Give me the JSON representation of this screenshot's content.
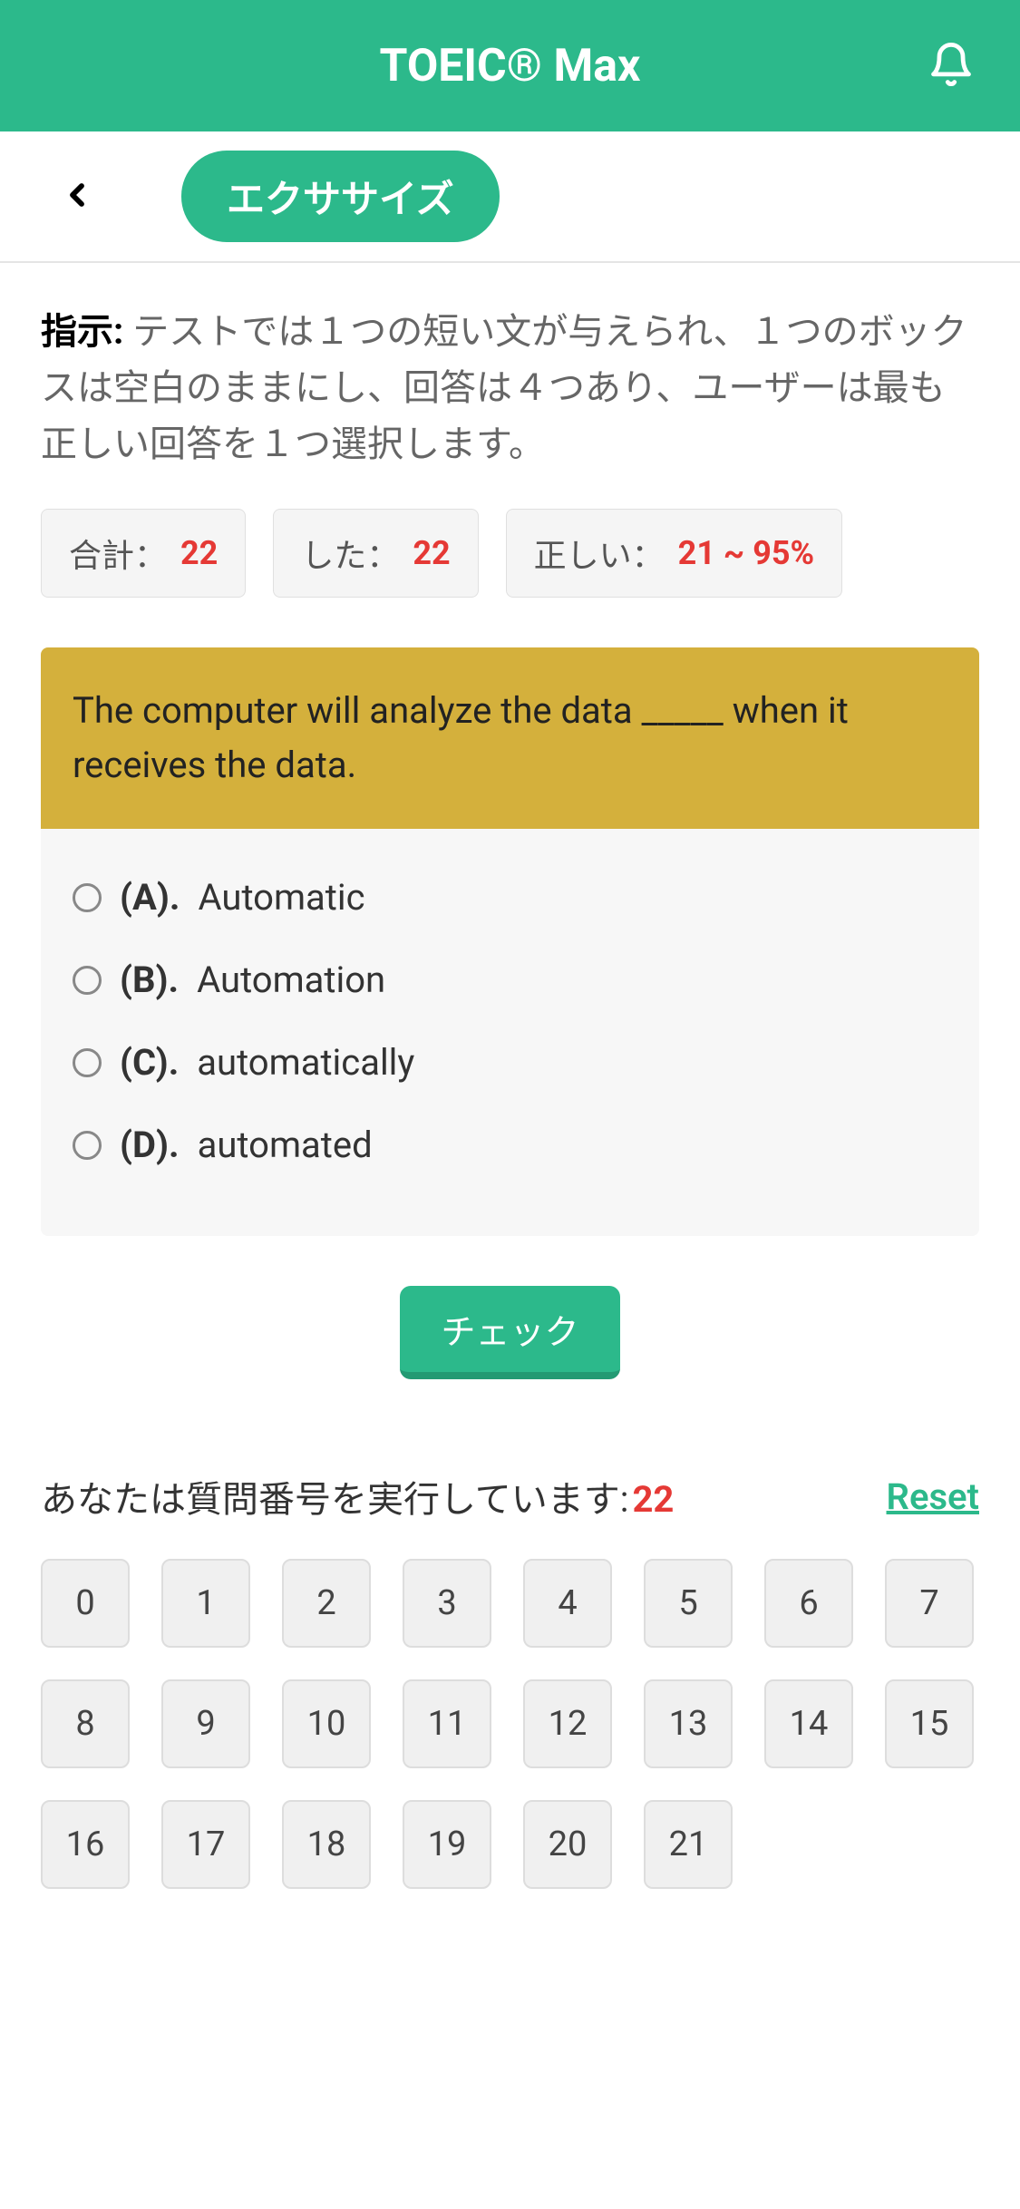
{
  "header": {
    "title": "TOEIC® Max"
  },
  "subheader": {
    "exercise_button": "エクササイズ"
  },
  "instructions": {
    "label": "指示:",
    "text": "テストでは１つの短い文が与えられ、１つのボックスは空白のままにし、回答は４つあり、ユーザーは最も正しい回答を１つ選択します。"
  },
  "stats": {
    "total_label": "合計：",
    "total_value": "22",
    "done_label": "した：",
    "done_value": "22",
    "correct_label": "正しい：",
    "correct_value": "21 ~ 95%"
  },
  "question": {
    "prompt": "The computer will analyze the data _____ when it receives the data.",
    "options": [
      {
        "letter": "(A).",
        "text": "Automatic"
      },
      {
        "letter": "(B).",
        "text": "Automation"
      },
      {
        "letter": "(C).",
        "text": "automatically"
      },
      {
        "letter": "(D).",
        "text": "automated"
      }
    ]
  },
  "check_button": "チェック",
  "nav": {
    "label": "あなたは質問番号を実行しています:",
    "current": "22",
    "reset": "Reset",
    "numbers": [
      "0",
      "1",
      "2",
      "3",
      "4",
      "5",
      "6",
      "7",
      "8",
      "9",
      "10",
      "11",
      "12",
      "13",
      "14",
      "15",
      "16",
      "17",
      "18",
      "19",
      "20",
      "21"
    ]
  }
}
